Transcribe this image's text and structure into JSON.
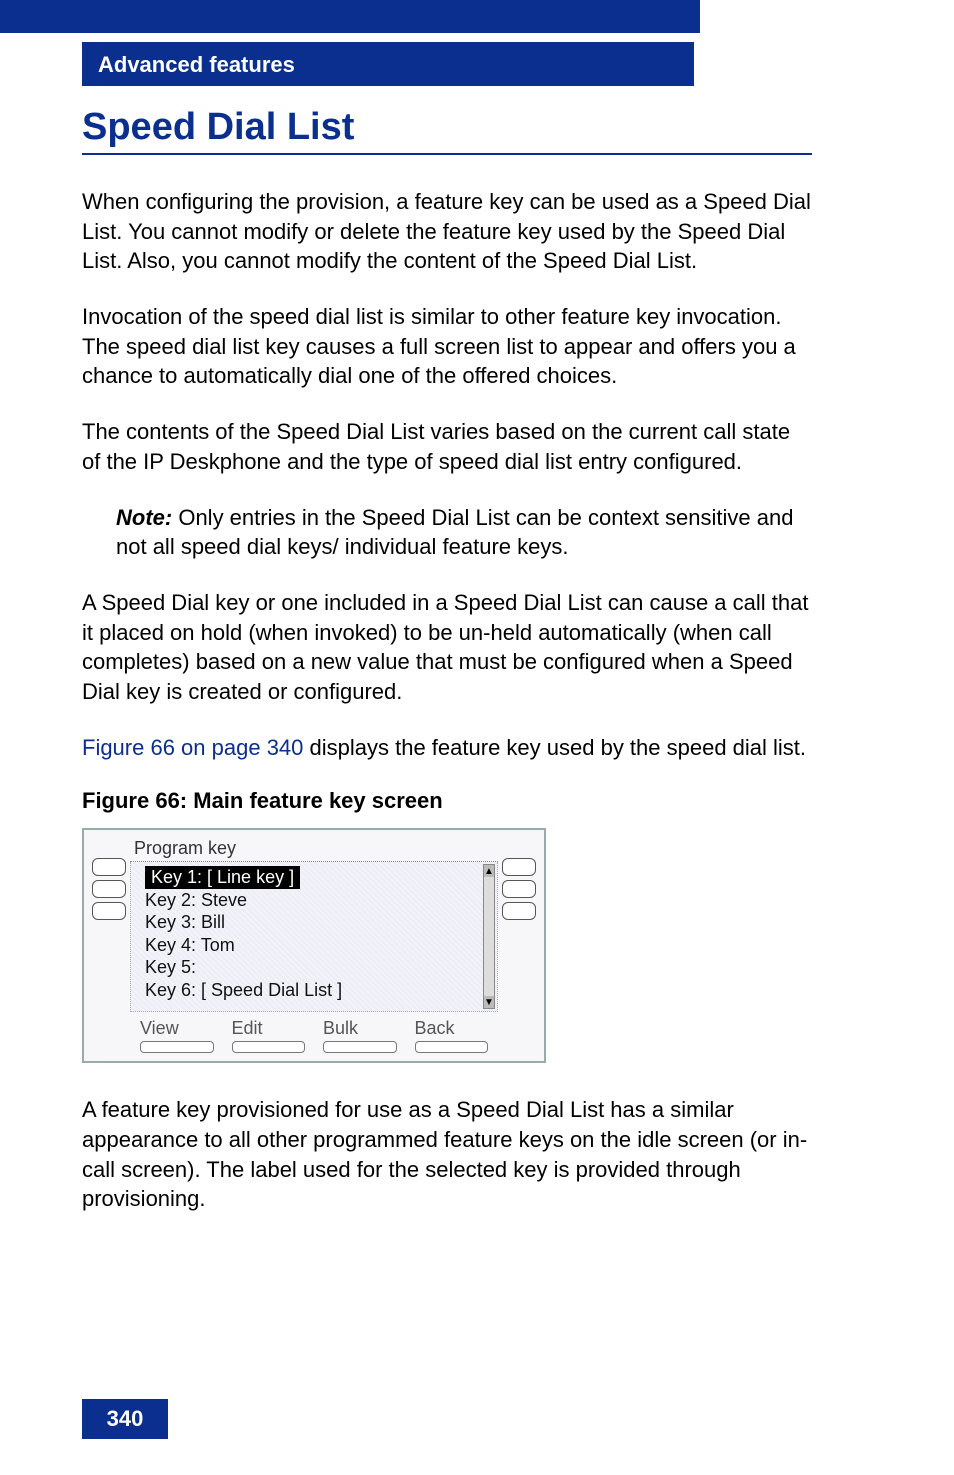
{
  "section_header": "Advanced features",
  "title": "Speed Dial List",
  "paragraphs": {
    "p1": "When configuring the provision, a feature key can be used as a Speed Dial List. You cannot modify or delete the feature key used by the Speed Dial List. Also, you cannot modify the content of the Speed Dial List.",
    "p2": "Invocation of the speed dial list is similar to other feature key invocation. The speed dial list key causes a full screen list to appear and offers you a chance to automatically dial one of the offered choices.",
    "p3": "The contents of the Speed Dial List varies based on the current call state of the IP Deskphone and the type of speed dial list entry configured.",
    "note_label": "Note:",
    "note_text": " Only entries in the Speed Dial List can be context sensitive and not all speed dial keys/ individual feature keys.",
    "p4": "A Speed Dial key or one included in a Speed Dial List can cause a call that it placed on hold (when invoked) to be un-held automatically (when call completes) based on a new value that must be configured when a Speed Dial key is created or configured.",
    "p5a": "Figure 66 on page 340",
    "p5b": " displays the feature key used by the speed dial list.",
    "p6": "A feature key provisioned for use as a Speed Dial List has a similar appearance to all other programmed feature keys on the idle screen (or in-call screen). The label used for the selected key is provided through provisioning."
  },
  "figure": {
    "caption": "Figure 66: Main feature key screen",
    "screen_title": "Program key",
    "items": [
      "Key 1: [ Line key ]",
      "Key 2: Steve",
      "Key 3: Bill",
      "Key 4: Tom",
      "Key 5:",
      "Key 6: [ Speed Dial List ]"
    ],
    "softkeys": [
      "View",
      "Edit",
      "Bulk",
      "Back"
    ]
  },
  "page_number": "340"
}
